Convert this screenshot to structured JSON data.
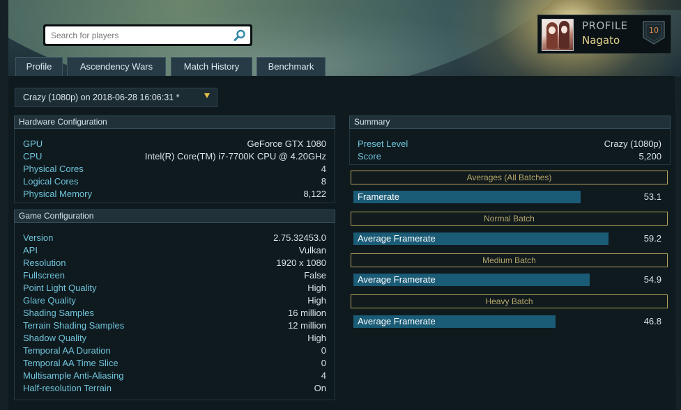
{
  "search": {
    "placeholder": "Search for players"
  },
  "profile": {
    "label": "PROFILE",
    "name": "Nagato",
    "level": "10"
  },
  "tabs": [
    {
      "label": "Profile"
    },
    {
      "label": "Ascendency Wars"
    },
    {
      "label": "Match History"
    },
    {
      "label": "Benchmark"
    }
  ],
  "run_selector": {
    "value": "Crazy (1080p) on 2018-06-28 16:06:31 *"
  },
  "hardware": {
    "title": "Hardware Configuration",
    "rows": [
      {
        "label": "GPU",
        "value": "GeForce GTX 1080"
      },
      {
        "label": "CPU",
        "value": "Intel(R) Core(TM) i7-7700K CPU @ 4.20GHz"
      },
      {
        "label": "Physical Cores",
        "value": "4"
      },
      {
        "label": "Logical Cores",
        "value": "8"
      },
      {
        "label": "Physical Memory",
        "value": "8,122"
      }
    ]
  },
  "game": {
    "title": "Game Configuration",
    "rows": [
      {
        "label": "Version",
        "value": "2.75.32453.0"
      },
      {
        "label": "API",
        "value": "Vulkan"
      },
      {
        "label": "Resolution",
        "value": "1920 x 1080"
      },
      {
        "label": "Fullscreen",
        "value": "False"
      },
      {
        "label": "Point Light Quality",
        "value": "High"
      },
      {
        "label": "Glare Quality",
        "value": "High"
      },
      {
        "label": "Shading Samples",
        "value": "16 million"
      },
      {
        "label": "Terrain Shading Samples",
        "value": "12 million"
      },
      {
        "label": "Shadow Quality",
        "value": "High"
      },
      {
        "label": "Temporal AA Duration",
        "value": "0"
      },
      {
        "label": "Temporal AA Time Slice",
        "value": "0"
      },
      {
        "label": "Multisample Anti-Aliasing",
        "value": "4"
      },
      {
        "label": "Half-resolution Terrain",
        "value": "On"
      }
    ]
  },
  "summary": {
    "title": "Summary",
    "rows": [
      {
        "label": "Preset Level",
        "value": "Crazy (1080p)"
      },
      {
        "label": "Score",
        "value": "5,200"
      }
    ],
    "batches": [
      {
        "title": "Averages (All Batches)",
        "label": "Framerate",
        "value": "53.1",
        "fill": 0.73
      },
      {
        "title": "Normal Batch",
        "label": "Average Framerate",
        "value": "59.2",
        "fill": 0.82
      },
      {
        "title": "Medium Batch",
        "label": "Average Framerate",
        "value": "54.9",
        "fill": 0.76
      },
      {
        "title": "Heavy Batch",
        "label": "Average Framerate",
        "value": "46.8",
        "fill": 0.65
      }
    ]
  },
  "colors": {
    "label": "#6fc4da",
    "bar": "#1a5b76",
    "batch_border": "#b8a65a",
    "profile_name": "#e6d38c",
    "level": "#e38a4a"
  },
  "icons": [
    "search-icon",
    "chevron-down-icon",
    "level-badge-icon",
    "avatar"
  ]
}
